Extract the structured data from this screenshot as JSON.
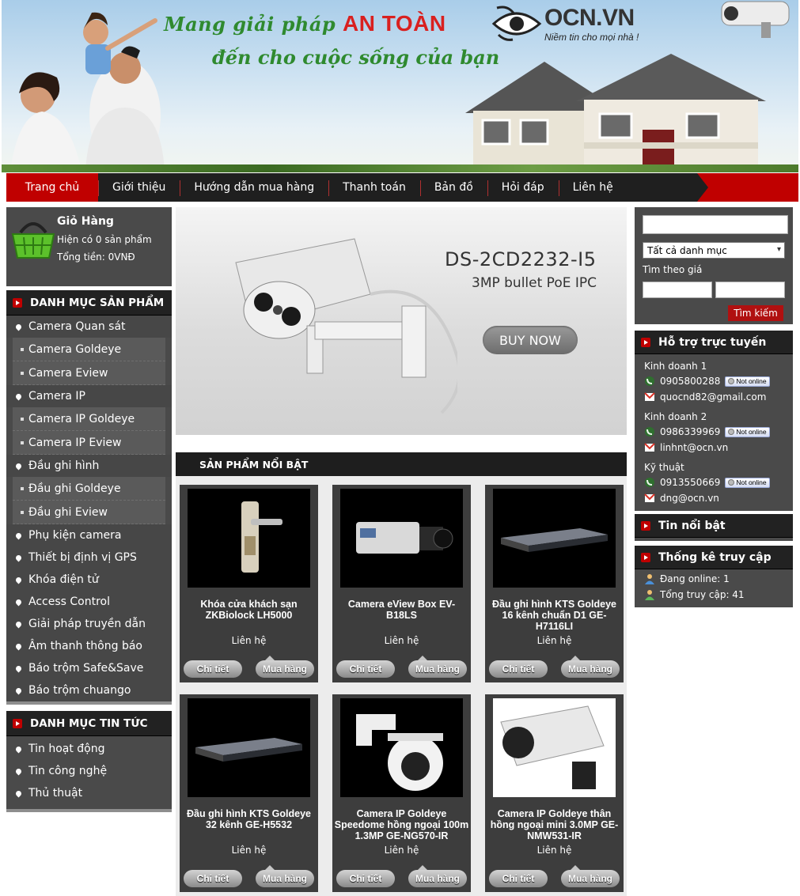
{
  "banner": {
    "slogan_line1_prefix": "Mang giải pháp",
    "slogan_line1_highlight": "AN TOÀN",
    "slogan_line2": "đến cho cuộc sống của bạn",
    "logo_text": "OCN.VN",
    "logo_tagline": "Niềm tin cho mọi nhà !"
  },
  "nav": {
    "items": [
      "Trang chủ",
      "Giới thiệu",
      "Hướng dẫn mua hàng",
      "Thanh toán",
      "Bản đồ",
      "Hỏi đáp",
      "Liên hệ"
    ],
    "active_index": 0
  },
  "cart": {
    "title": "Giỏ Hàng",
    "count_text": "Hiện có 0 sản phẩm",
    "total_text": "Tổng tiền: 0VNĐ"
  },
  "product_categories": {
    "title": "DANH MỤC SẢN PHẨM",
    "items": [
      {
        "label": "Camera Quan sát",
        "level": 1
      },
      {
        "label": "Camera Goldeye",
        "level": 2
      },
      {
        "label": "Camera Eview",
        "level": 2
      },
      {
        "label": "Camera IP",
        "level": 1
      },
      {
        "label": "Camera IP Goldeye",
        "level": 2
      },
      {
        "label": "Camera IP Eview",
        "level": 2
      },
      {
        "label": "Đầu ghi hình",
        "level": 1
      },
      {
        "label": "Đầu ghi Goldeye",
        "level": 2
      },
      {
        "label": "Đầu ghi Eview",
        "level": 2
      },
      {
        "label": "Phụ kiện camera",
        "level": 1
      },
      {
        "label": "Thiết bị định vị GPS",
        "level": 1
      },
      {
        "label": "Khóa điện tử",
        "level": 1
      },
      {
        "label": "Access Control",
        "level": 1
      },
      {
        "label": "Giải pháp truyền dẫn",
        "level": 1
      },
      {
        "label": "Âm thanh thông báo",
        "level": 1
      },
      {
        "label": "Báo trộm Safe&Save",
        "level": 1
      },
      {
        "label": "Báo trộm chuango",
        "level": 1
      }
    ]
  },
  "news_categories": {
    "title": "DANH MỤC TIN TỨC",
    "items": [
      "Tin hoạt động",
      "Tin công nghệ",
      "Thủ thuật"
    ]
  },
  "slider": {
    "model": "DS-2CD2232-I5",
    "subtitle": "3MP bullet PoE IPC",
    "button": "BUY NOW"
  },
  "featured": {
    "title": "SẢN PHẨM NỔI BẬT",
    "detail_label": "Chi tiết",
    "cart_label": "Mua hàng",
    "products": [
      {
        "name": "Khóa cửa khách sạn ZKBiolock LH5000",
        "price": "Liên hệ",
        "icon": "door-lock-image"
      },
      {
        "name": "Camera eView Box EV-B18LS",
        "price": "Liên hệ",
        "icon": "box-camera-image"
      },
      {
        "name": "Đầu ghi hình KTS Goldeye 16 kênh chuẩn D1 GE-H7116LI",
        "price": "Liên hệ",
        "icon": "dvr-image"
      },
      {
        "name": "Đầu ghi hình KTS Goldeye 32 kênh GE-H5532",
        "price": "Liên hệ",
        "icon": "dvr-image"
      },
      {
        "name": "Camera IP Goldeye Speedome hồng ngoại 100m 1.3MP GE-NG570-IR",
        "price": "Liên hệ",
        "icon": "speed-dome-image"
      },
      {
        "name": "Camera IP Goldeye thân hồng ngoại mini 3.0MP GE-NMW531-IR",
        "price": "Liên hệ",
        "icon": "bullet-camera-image"
      }
    ]
  },
  "search": {
    "category_select": "Tất cả danh mục",
    "price_label": "Tìm theo giá",
    "button": "Tìm kiếm"
  },
  "support": {
    "title": "Hỗ trợ trực tuyến",
    "status_text": "Not online",
    "contacts": [
      {
        "role": "Kinh doanh 1",
        "phone": "0905800288",
        "email": "quocnd82@gmail.com"
      },
      {
        "role": "Kinh doanh 2",
        "phone": "0986339969",
        "email": "linhnt@ocn.vn"
      },
      {
        "role": "Kỹ thuật",
        "phone": "0913550669",
        "email": "dng@ocn.vn"
      }
    ]
  },
  "hot_news": {
    "title": "Tin nổi bật"
  },
  "stats": {
    "title": "Thống kê truy cập",
    "online": "Đang online: 1",
    "total": "Tổng truy cập: 41"
  },
  "colors": {
    "accent_red": "#c00000",
    "panel": "#4a4a4a",
    "header_dark": "#222222",
    "slogan_green": "#2f8a2f"
  }
}
